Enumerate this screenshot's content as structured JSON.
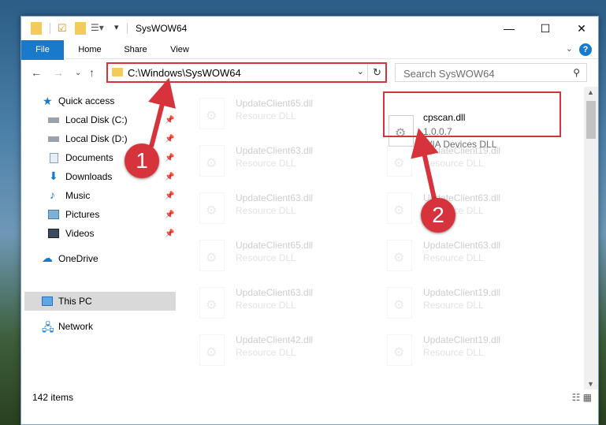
{
  "window": {
    "title": "SysWOW64"
  },
  "ribbon": {
    "tabs": [
      "File",
      "Home",
      "Share",
      "View"
    ],
    "help": "?"
  },
  "address": {
    "path": "C:\\Windows\\SysWOW64"
  },
  "search": {
    "placeholder": "Search SysWOW64"
  },
  "sidebar": {
    "quick_access": "Quick access",
    "items": [
      "Local Disk (C:)",
      "Local Disk (D:)",
      "Documents",
      "Downloads",
      "Music",
      "Pictures",
      "Videos"
    ],
    "onedrive": "OneDrive",
    "thispc": "This PC",
    "network": "Network"
  },
  "files": {
    "left": [
      {
        "name": "UpdateClient65.dll",
        "desc": "Resource DLL"
      },
      {
        "name": "UpdateClient63.dll",
        "desc": "Resource DLL"
      },
      {
        "name": "UpdateClient63.dll",
        "desc": "Resource DLL"
      },
      {
        "name": "UpdateClient65.dll",
        "desc": "Resource DLL"
      },
      {
        "name": "UpdateClient63.dll",
        "desc": "Resource DLL"
      },
      {
        "name": "UpdateClient42.dll",
        "desc": "Resource DLL"
      }
    ],
    "right": [
      {
        "name": "UpdateClient19.dll",
        "desc": "Resource DLL"
      },
      {
        "name": "UpdateClient63.dll",
        "desc": "Resource DLL"
      },
      {
        "name": "UpdateClient63.dll",
        "desc": "Resource DLL"
      },
      {
        "name": "UpdateClient19.dll",
        "desc": "Resource DLL"
      },
      {
        "name": "UpdateClient19.dll",
        "desc": "Resource DLL"
      }
    ],
    "highlight": {
      "name": "cpscan.dll",
      "version": "1.0.0.7",
      "desc": "WIA Devices DLL"
    }
  },
  "status": {
    "count": "142 items"
  },
  "markers": [
    "1",
    "2"
  ],
  "colors": {
    "accent": "#1979ca",
    "annotation": "#d6333c"
  }
}
